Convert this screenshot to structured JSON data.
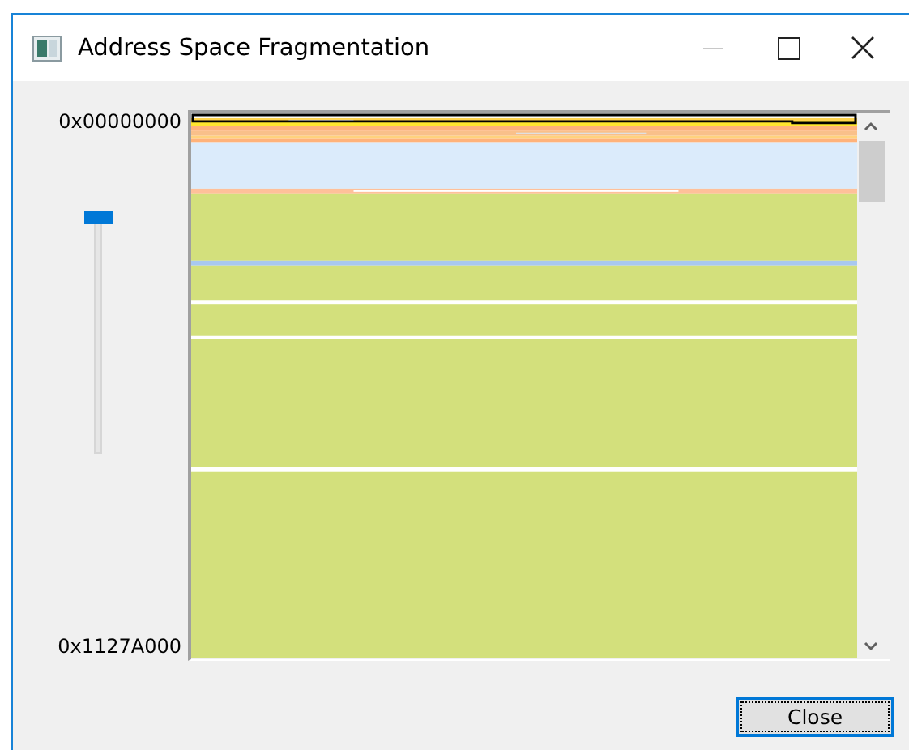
{
  "window": {
    "title": "Address Space Fragmentation"
  },
  "map": {
    "start_address": "0x00000000",
    "end_address": "0x1127A000"
  },
  "zoom_slider": {
    "level": 0
  },
  "buttons": [
    {
      "label": "Close",
      "focused": true
    }
  ]
}
